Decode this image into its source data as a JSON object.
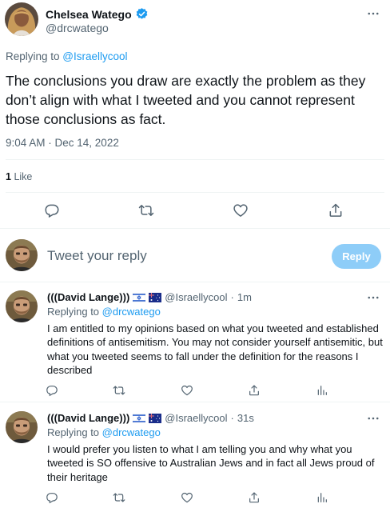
{
  "main_tweet": {
    "author_name": "Chelsea Watego",
    "author_handle": "@drcwatego",
    "replying_prefix": "Replying to ",
    "replying_to": "@Israellycool",
    "text": "The conclusions you draw are exactly the problem as they don’t align with what I tweeted and you cannot represent those conclusions as fact.",
    "timestamp": "9:04 AM · Dec 14, 2022",
    "like_count": "1",
    "like_label": "Like"
  },
  "compose": {
    "placeholder": "Tweet your reply",
    "button_label": "Reply"
  },
  "replies": [
    {
      "author_name": "(((David Lange)))",
      "author_handle": "@Israellycool",
      "time": "1m",
      "replying_prefix": "Replying to ",
      "replying_to": "@drcwatego",
      "text": "I am entitled to my opinions based on what you tweeted and established definitions of antisemitism. You may not consider yourself antisemitic, but what you tweeted seems to fall under the definition for the reasons I described"
    },
    {
      "author_name": "(((David Lange)))",
      "author_handle": "@Israellycool",
      "time": "31s",
      "replying_prefix": "Replying to ",
      "replying_to": "@drcwatego",
      "text": "I would prefer you listen to what I am telling you and why what you tweeted is SO offensive to Australian Jews and in fact all Jews proud of their heritage"
    }
  ],
  "separator": "·",
  "icons": {
    "verified": "verified-badge-icon",
    "more": "more-icon",
    "reply": "reply-icon",
    "retweet": "retweet-icon",
    "like": "like-icon",
    "share": "share-icon",
    "analytics": "analytics-icon",
    "flag_il": "israel-flag-icon",
    "flag_au": "australia-flag-icon"
  },
  "colors": {
    "accent": "#1d9bf0",
    "text": "#0f1419",
    "muted": "#536471",
    "divider": "#eff3f4",
    "reply_button_disabled": "#8ecdf8"
  }
}
